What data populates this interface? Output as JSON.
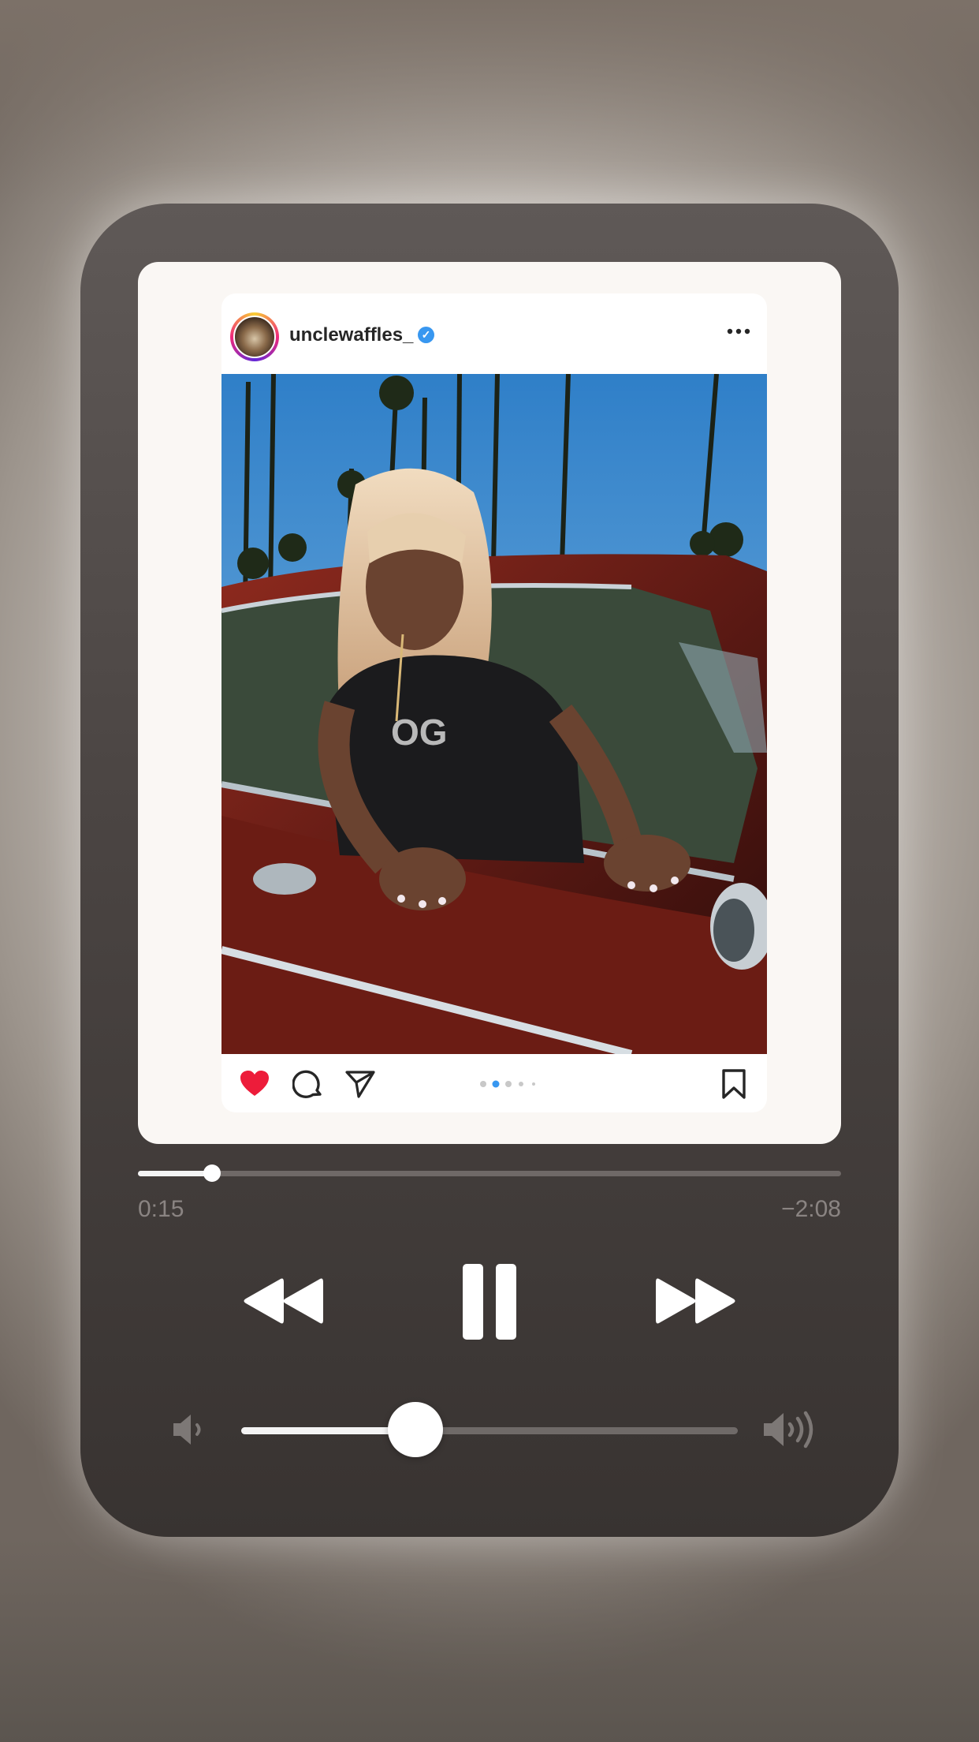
{
  "post": {
    "username": "unclewaffles_",
    "verified_mark": "✓",
    "carousel_total": 5,
    "carousel_active": 2,
    "liked": true
  },
  "player": {
    "elapsed": "0:15",
    "remaining": "−2:08",
    "progress_fraction": 0.105,
    "volume_fraction": 0.35,
    "state": "playing"
  },
  "colors": {
    "like": "#ed1c3a",
    "verified": "#3897f0",
    "carousel_active": "#3897f0"
  },
  "icons": {
    "avatar": "avatar",
    "more": "more-icon",
    "like": "heart-icon",
    "comment": "comment-icon",
    "share": "share-icon",
    "save": "bookmark-icon",
    "rewind": "rewind-icon",
    "pause": "pause-icon",
    "forward": "fast-forward-icon",
    "volume_low": "volume-low-icon",
    "volume_high": "volume-high-icon"
  }
}
